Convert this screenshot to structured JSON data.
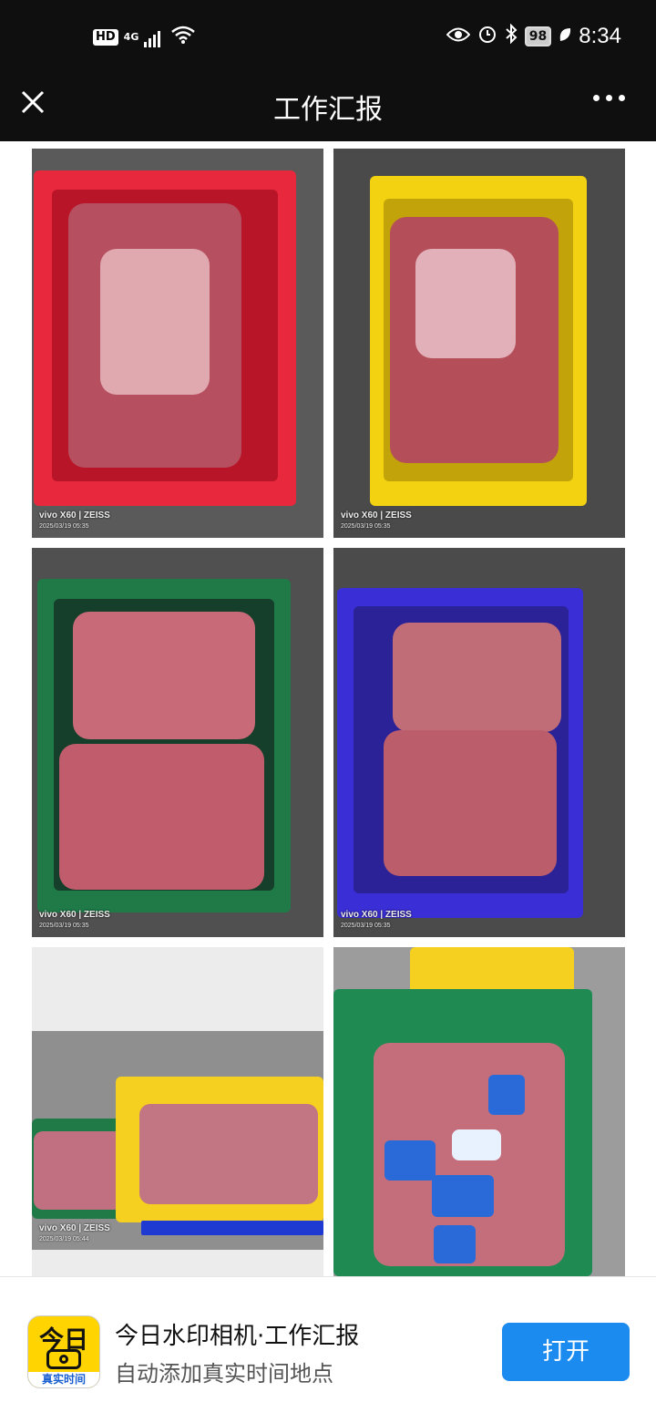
{
  "status_bar": {
    "left_badge": "HD",
    "network": "4G",
    "battery": "98",
    "time": "8:34"
  },
  "nav": {
    "title": "工作汇报",
    "close_icon": "close-icon",
    "more_icon": "more-icon"
  },
  "photos": [
    {
      "watermark_brand": "vivo X60 | ZEISS",
      "watermark_time": "2025/03/19 05:35",
      "crate_color": "#e8283d"
    },
    {
      "watermark_brand": "vivo X60 | ZEISS",
      "watermark_time": "2025/03/19 05:35",
      "crate_color": "#f2d211"
    },
    {
      "watermark_brand": "vivo X60 | ZEISS",
      "watermark_time": "2025/03/19 05:35",
      "crate_color": "#1f7a48"
    },
    {
      "watermark_brand": "vivo X60 | ZEISS",
      "watermark_time": "2025/03/19 05:35",
      "crate_color": "#3a2fd6"
    },
    {
      "watermark_brand": "vivo X60 | ZEISS",
      "watermark_time": "2025/03/19 05:44",
      "crate_color": "#f5d020"
    },
    {
      "watermark_brand": "",
      "watermark_time": "",
      "crate_color": "#1f8a52"
    }
  ],
  "app_banner": {
    "icon_top_text": "今日",
    "icon_bottom_text": "真实时间",
    "name": "今日水印相机·工作汇报",
    "subtitle": "自动添加真实时间地点",
    "open_label": "打开"
  }
}
